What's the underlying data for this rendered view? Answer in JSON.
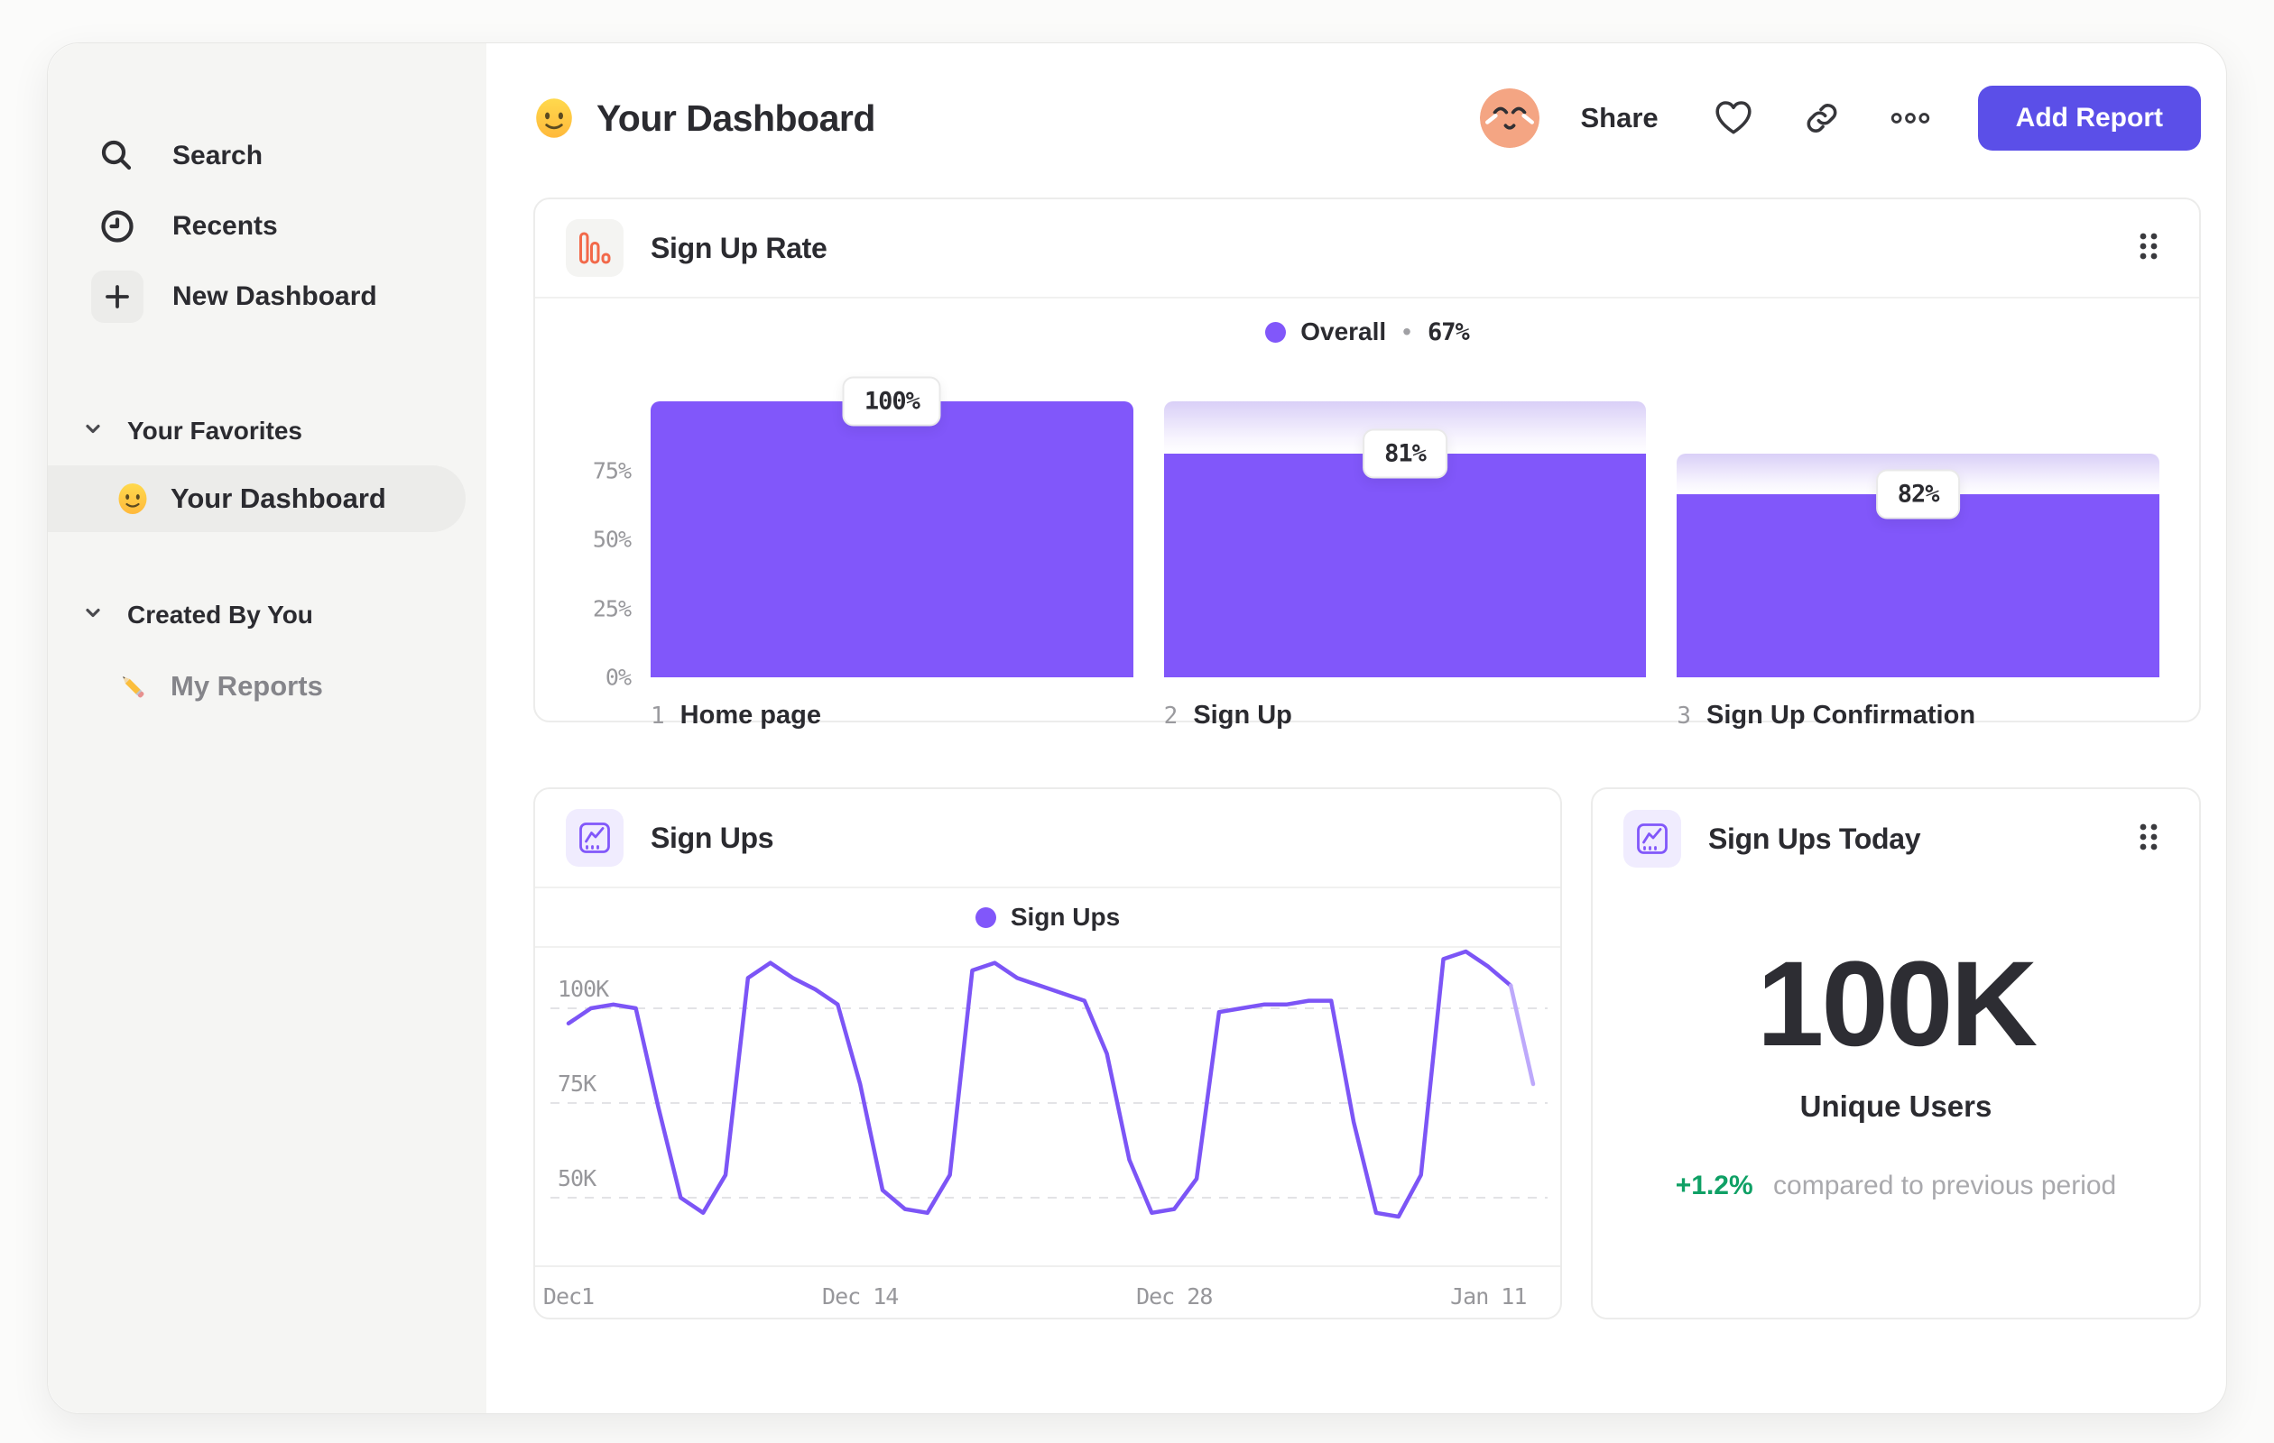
{
  "sidebar": {
    "nav": [
      {
        "label": "Search",
        "icon": "search-icon"
      },
      {
        "label": "Recents",
        "icon": "clock-icon"
      },
      {
        "label": "New Dashboard",
        "icon": "plus-icon"
      }
    ],
    "sections": [
      {
        "label": "Your Favorites",
        "icon": "chevron-down-icon",
        "items": [
          {
            "label": "Your Dashboard",
            "icon": "smiley-emoji",
            "selected": true
          }
        ]
      },
      {
        "label": "Created By You",
        "icon": "chevron-down-icon",
        "items": [
          {
            "label": "My Reports",
            "icon": "pencil-emoji",
            "selected": false
          }
        ]
      }
    ]
  },
  "header": {
    "emoji": "slightly-smiling-face",
    "title": "Your Dashboard",
    "share_label": "Share",
    "action_icons": [
      "favorite-heart-icon",
      "copy-link-icon",
      "more-options-icon"
    ],
    "add_report_label": "Add Report"
  },
  "funnel_card": {
    "title": "Sign Up Rate",
    "icon": "funnel-chart-icon",
    "legend": {
      "series": "Overall",
      "separator": "•",
      "value": "67%"
    }
  },
  "line_card": {
    "title": "Sign Ups",
    "icon": "line-chart-icon",
    "legend": {
      "series": "Sign Ups"
    }
  },
  "today_card": {
    "title": "Sign Ups Today",
    "icon": "line-chart-icon",
    "value": "100K",
    "metric": "Unique Users",
    "delta": "+1.2%",
    "delta_note": "compared to previous period"
  },
  "colors": {
    "accent_purple": "#8157FA",
    "line_purple": "#7C55F6",
    "line_faded": "#BDA9FB",
    "button_purple": "#5B4FE8",
    "funnel_icon_orange": "#F2694A",
    "delta_green": "#0FA065"
  },
  "chart_data": [
    {
      "type": "bar",
      "subtype": "funnel",
      "title": "Sign Up Rate",
      "legend": "Overall",
      "overall_conversion": "67%",
      "categories": [
        "Home page",
        "Sign Up",
        "Sign Up Confirmation"
      ],
      "step_numbers": [
        "1",
        "2",
        "3"
      ],
      "step_conversion_labels": [
        "100%",
        "81%",
        "82%"
      ],
      "step_conversion_values": [
        100,
        81,
        82
      ],
      "overall_percent": [
        100,
        81,
        66.4
      ],
      "gradient_top_percent": [
        100,
        100,
        81
      ],
      "ylim": [
        0,
        100
      ],
      "y_ticks": [
        {
          "label": "75%",
          "value": 75
        },
        {
          "label": "50%",
          "value": 50
        },
        {
          "label": "25%",
          "value": 25
        },
        {
          "label": "0%",
          "value": 0
        }
      ],
      "grid": false,
      "legend_position": "top-center",
      "bar_color": "#8157FA"
    },
    {
      "type": "line",
      "title": "Sign Ups",
      "legend": [
        "Sign Ups"
      ],
      "legend_position": "top-center",
      "x": [
        "Dec 1",
        "Dec 2",
        "Dec 3",
        "Dec 4",
        "Dec 5",
        "Dec 6",
        "Dec 7",
        "Dec 8",
        "Dec 9",
        "Dec 10",
        "Dec 11",
        "Dec 12",
        "Dec 13",
        "Dec 14",
        "Dec 15",
        "Dec 16",
        "Dec 17",
        "Dec 18",
        "Dec 19",
        "Dec 20",
        "Dec 21",
        "Dec 22",
        "Dec 23",
        "Dec 24",
        "Dec 25",
        "Dec 26",
        "Dec 27",
        "Dec 28",
        "Dec 29",
        "Dec 30",
        "Dec 31",
        "Jan 1",
        "Jan 2",
        "Jan 3",
        "Jan 4",
        "Jan 5",
        "Jan 6",
        "Jan 7",
        "Jan 8",
        "Jan 9",
        "Jan 10",
        "Jan 11",
        "Jan 12",
        "Jan 13"
      ],
      "values_k": [
        96,
        100,
        101,
        100,
        74,
        50,
        46,
        56,
        108,
        112,
        108,
        105,
        101,
        80,
        52,
        47,
        46,
        56,
        110,
        112,
        108,
        106,
        104,
        102,
        88,
        60,
        46,
        47,
        55,
        99,
        100,
        101,
        101,
        102,
        102,
        70,
        46,
        45,
        56,
        113,
        115,
        111,
        106,
        80
      ],
      "unit": "K users",
      "faded_from_index": 42,
      "x_tick_labels": [
        "Dec1",
        "Dec 14",
        "Dec 28",
        "Jan 11"
      ],
      "x_tick_day_index": [
        0,
        13,
        27,
        41
      ],
      "y_ticks": [
        {
          "label": "100K",
          "value": 100
        },
        {
          "label": "75K",
          "value": 75
        },
        {
          "label": "50K",
          "value": 50
        }
      ],
      "ylim_k": [
        35,
        120
      ],
      "grid": "dashed-horizontal",
      "line_color": "#7C55F6",
      "faded_color": "#BDA9FB"
    }
  ]
}
